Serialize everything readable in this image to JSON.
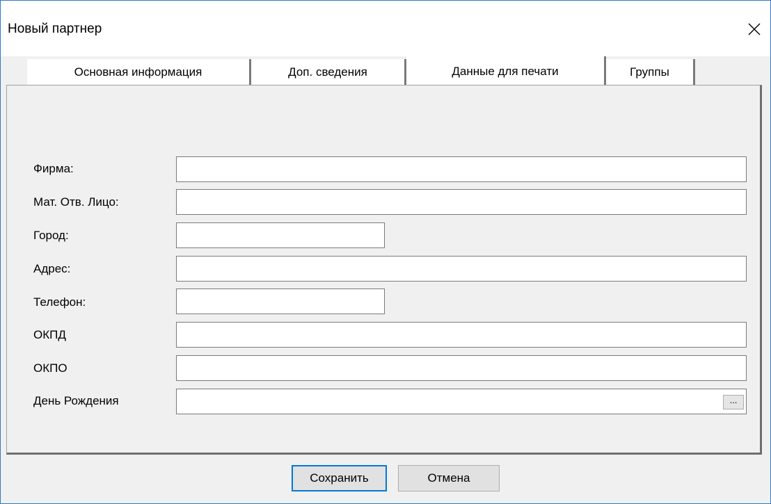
{
  "window": {
    "title": "Новый партнер",
    "close_icon": "close-icon"
  },
  "tabs": [
    {
      "label": "Основная информация",
      "active": false
    },
    {
      "label": "Доп. сведения",
      "active": false
    },
    {
      "label": "Данные для печати",
      "active": true
    },
    {
      "label": "Группы",
      "active": false
    }
  ],
  "form": {
    "firma_label": "Фирма:",
    "firma_value": "",
    "mol_label": "Мат. Отв. Лицо:",
    "mol_value": "",
    "gorod_label": "Город:",
    "gorod_value": "",
    "adres_label": "Адрес:",
    "adres_value": "",
    "telefon_label": "Телефон:",
    "telefon_value": "",
    "okpd_label": "ОКПД",
    "okpd_value": "",
    "okpo_label": "ОКПО",
    "okpo_value": "",
    "birthday_label": "День Рождения",
    "birthday_value": "",
    "birthday_button": "..."
  },
  "buttons": {
    "save": "Сохранить",
    "cancel": "Отмена"
  },
  "colors": {
    "window_border": "#2b79c9",
    "default_button_border": "#0078d7",
    "dialog_background": "#f0f0f0"
  }
}
